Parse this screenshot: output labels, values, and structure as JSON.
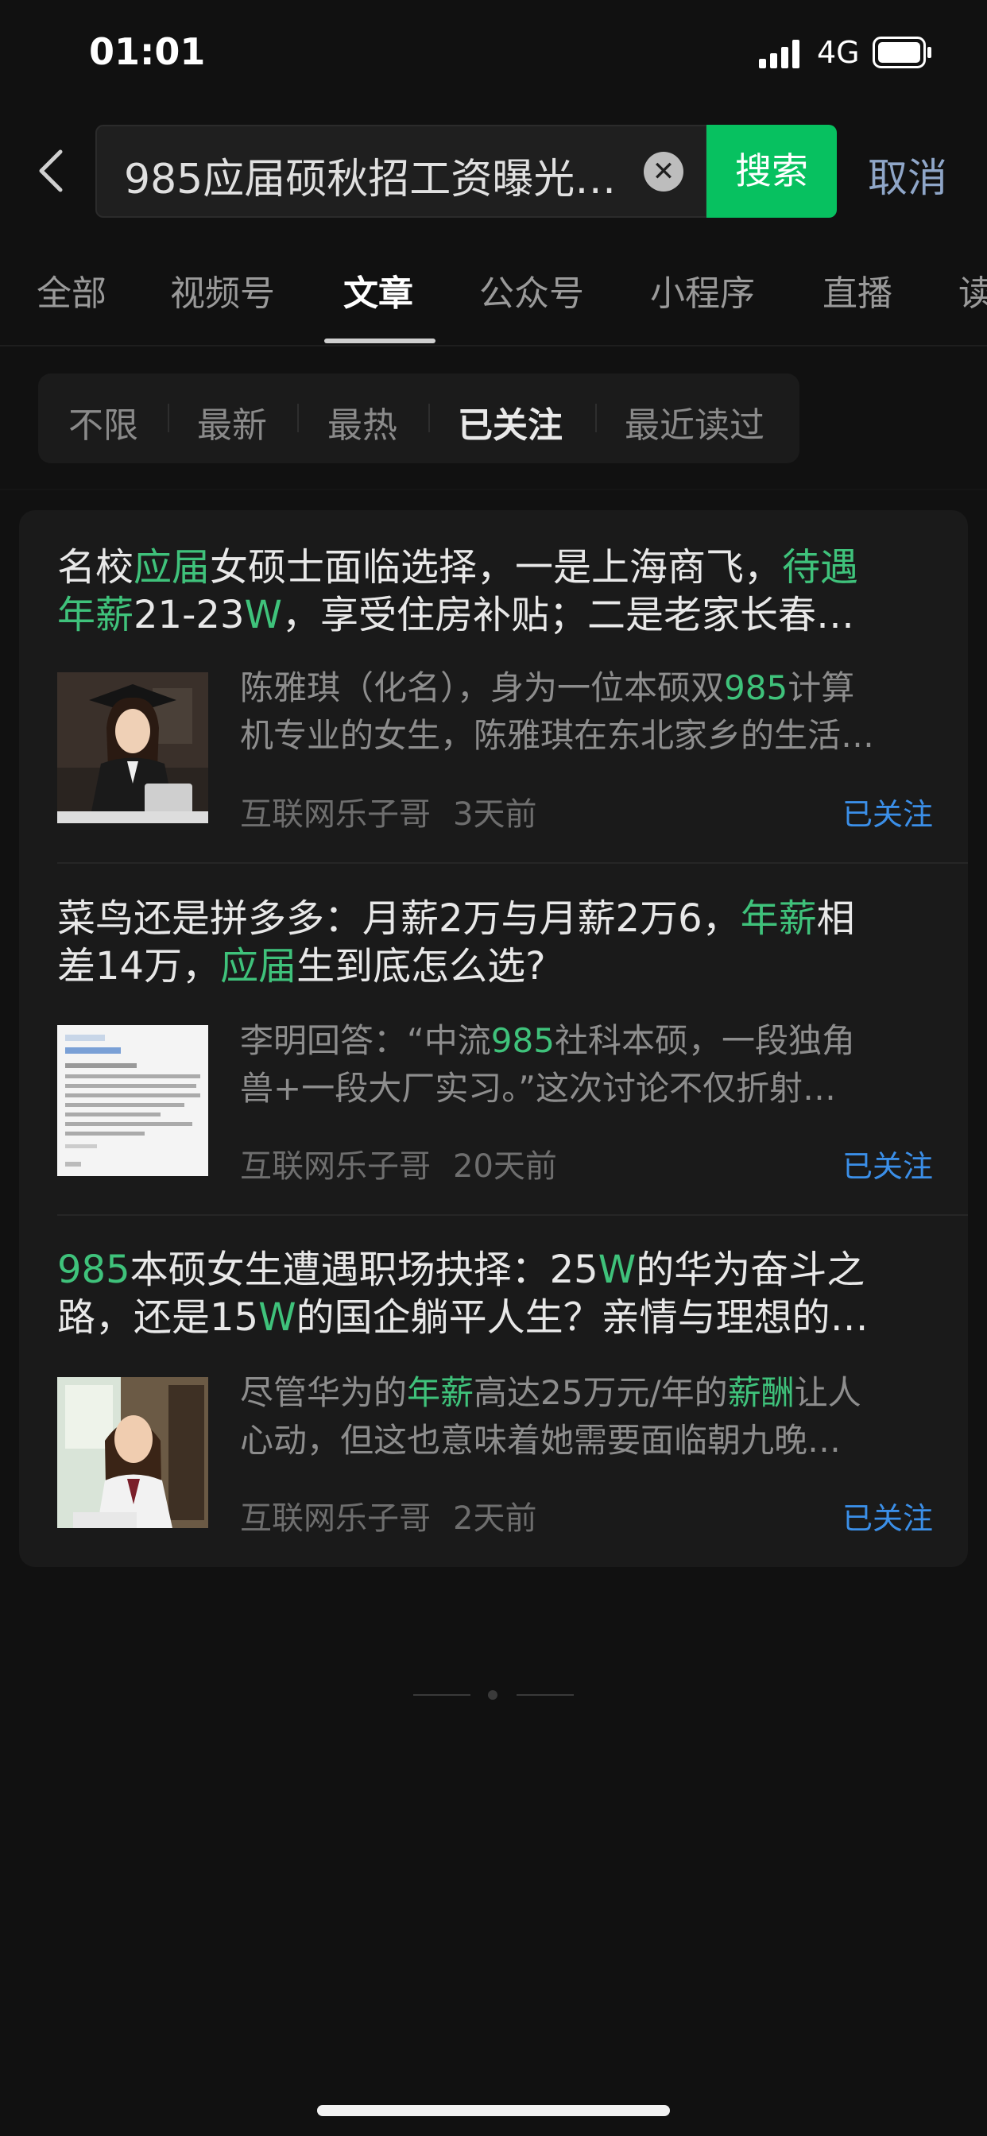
{
  "status_bar": {
    "time": "01:01",
    "network": "4G"
  },
  "search": {
    "query": "985应届硕秋招工资曝光…",
    "search_label": "搜索",
    "cancel_label": "取消"
  },
  "tabs": [
    {
      "label": "全部"
    },
    {
      "label": "视频号"
    },
    {
      "label": "文章",
      "active": true
    },
    {
      "label": "公众号"
    },
    {
      "label": "小程序"
    },
    {
      "label": "直播"
    },
    {
      "label": "读"
    }
  ],
  "filters": [
    {
      "label": "不限"
    },
    {
      "label": "最新"
    },
    {
      "label": "最热"
    },
    {
      "label": "已关注",
      "active": true
    },
    {
      "label": "最近读过"
    }
  ],
  "articles": [
    {
      "title_line1": [
        "名校",
        {
          "hl": "应届"
        },
        "女硕士面临选择，一是上海商飞，",
        {
          "hl": "待遇"
        }
      ],
      "title_line2": [
        {
          "hl": "年薪"
        },
        "21-23",
        {
          "hl": "W"
        },
        "，享受住房补贴；二是老家长春…"
      ],
      "summary_line1": [
        "陈雅琪（化名），身为一位本硕双",
        {
          "hl": "985"
        },
        "计算"
      ],
      "summary_line2": [
        "机专业的女生，陈雅琪在东北家乡的生活…"
      ],
      "author": "互联网乐子哥",
      "time": "3天前",
      "status": "已关注",
      "thumb_icon": "graduate-woman-photo"
    },
    {
      "title_line1": [
        "菜鸟还是拼多多：月薪2万与月薪2万6，",
        {
          "hl": "年薪"
        },
        "相"
      ],
      "title_line2": [
        "差14万，",
        {
          "hl": "应届"
        },
        "生到底怎么选?"
      ],
      "summary_line1": [
        "李明回答：“中流",
        {
          "hl": "985"
        },
        "社科本硕，一段独角"
      ],
      "summary_line2": [
        "兽+一段大厂实习。”这次讨论不仅折射…"
      ],
      "author": "互联网乐子哥",
      "time": "20天前",
      "status": "已关注",
      "thumb_icon": "document-screenshot"
    },
    {
      "title_line1": [
        {
          "hl": "985"
        },
        "本硕女生遭遇职场抉择：25",
        {
          "hl": "W"
        },
        "的华为奋斗之"
      ],
      "title_line2": [
        "路，还是15",
        {
          "hl": "W"
        },
        "的国企躺平人生？亲情与理想的…"
      ],
      "summary_line1": [
        "尽管华为的",
        {
          "hl": "年薪"
        },
        "高达25万元/年的",
        {
          "hl": "薪酬"
        },
        "让人"
      ],
      "summary_line2": [
        "心动，但这也意味着她需要面临朝九晚…"
      ],
      "author": "互联网乐子哥",
      "time": "2天前",
      "status": "已关注",
      "thumb_icon": "woman-by-window-photo"
    }
  ],
  "colors": {
    "accent": "#07c160",
    "highlight": "#3fc27b",
    "link": "#3b8fe8",
    "background": "#111111"
  }
}
